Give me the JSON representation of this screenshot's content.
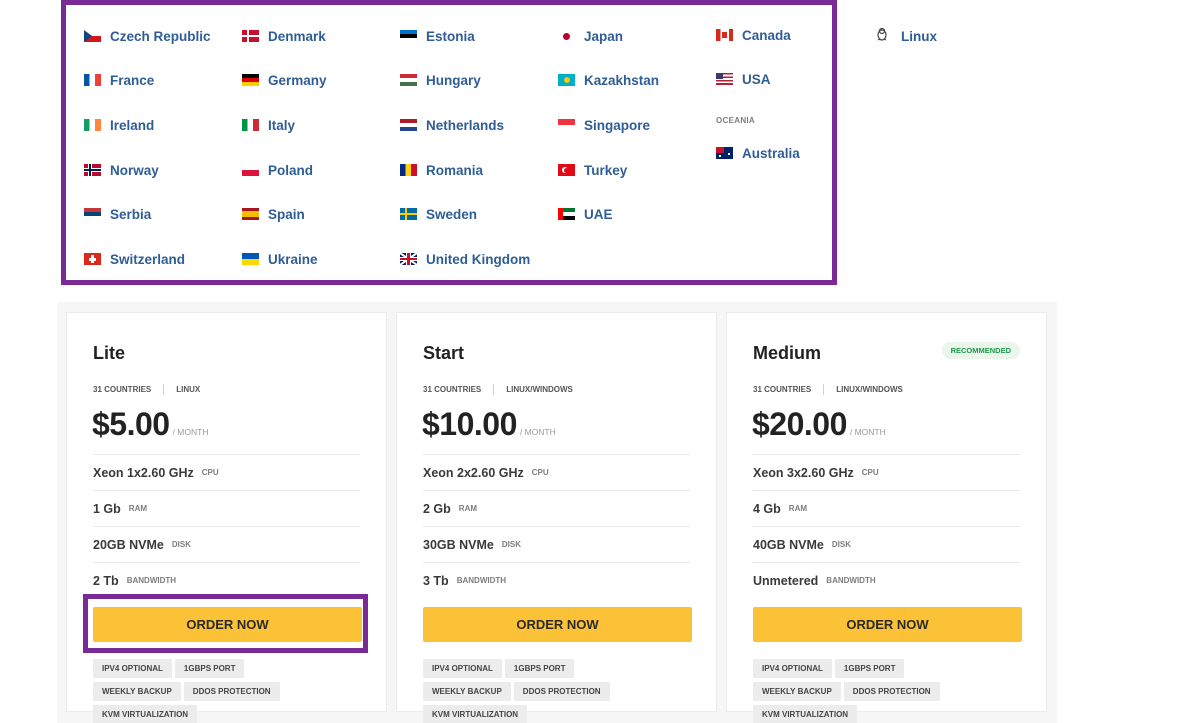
{
  "locations": {
    "europe_col1": [
      "Czech Republic",
      "France",
      "Ireland",
      "Norway",
      "Serbia",
      "Switzerland"
    ],
    "europe_col2": [
      "Denmark",
      "Germany",
      "Italy",
      "Poland",
      "Spain",
      "Ukraine"
    ],
    "europe_col3": [
      "Estonia",
      "Hungary",
      "Netherlands",
      "Romania",
      "Sweden",
      "United Kingdom"
    ],
    "asia_col": [
      "Japan",
      "Kazakhstan",
      "Singapore",
      "Turkey",
      "UAE"
    ],
    "americas_col": [
      "Canada",
      "USA"
    ],
    "oceania_label": "OCEANIA",
    "oceania": [
      "Australia"
    ],
    "os": [
      "Linux"
    ]
  },
  "plans": [
    {
      "name": "Lite",
      "countries": "31 COUNTRIES",
      "os": "LINUX",
      "price": "$5.00",
      "period": "/ MONTH",
      "cpu": "Xeon 1x2.60 GHz",
      "ram": "1 Gb",
      "disk": "20GB NVMe",
      "bandwidth": "2 Tb",
      "order_label": "ORDER NOW",
      "tags": [
        "IPV4 OPTIONAL",
        "1GBPS PORT",
        "WEEKLY BACKUP",
        "DDOS PROTECTION",
        "KVM VIRTUALIZATION"
      ]
    },
    {
      "name": "Start",
      "countries": "31 COUNTRIES",
      "os": "LINUX/WINDOWS",
      "price": "$10.00",
      "period": "/ MONTH",
      "cpu": "Xeon 2x2.60 GHz",
      "ram": "2 Gb",
      "disk": "30GB NVMe",
      "bandwidth": "3 Tb",
      "order_label": "ORDER NOW",
      "tags": [
        "IPV4 OPTIONAL",
        "1GBPS PORT",
        "WEEKLY BACKUP",
        "DDOS PROTECTION",
        "KVM VIRTUALIZATION"
      ]
    },
    {
      "name": "Medium",
      "badge": "RECOMMENDED",
      "countries": "31 COUNTRIES",
      "os": "LINUX/WINDOWS",
      "price": "$20.00",
      "period": "/ MONTH",
      "cpu": "Xeon 3x2.60 GHz",
      "ram": "4 Gb",
      "disk": "40GB NVMe",
      "bandwidth": "Unmetered",
      "order_label": "ORDER NOW",
      "tags": [
        "IPV4 OPTIONAL",
        "1GBPS PORT",
        "WEEKLY BACKUP",
        "DDOS PROTECTION",
        "KVM VIRTUALIZATION"
      ]
    }
  ],
  "spec_units": {
    "cpu": "CPU",
    "ram": "RAM",
    "disk": "DISK",
    "bandwidth": "BANDWIDTH"
  },
  "colors": {
    "link": "#2f5d95",
    "highlight": "#7a2a97",
    "order_button": "#fbc237",
    "badge_text": "#1f9a4a"
  }
}
